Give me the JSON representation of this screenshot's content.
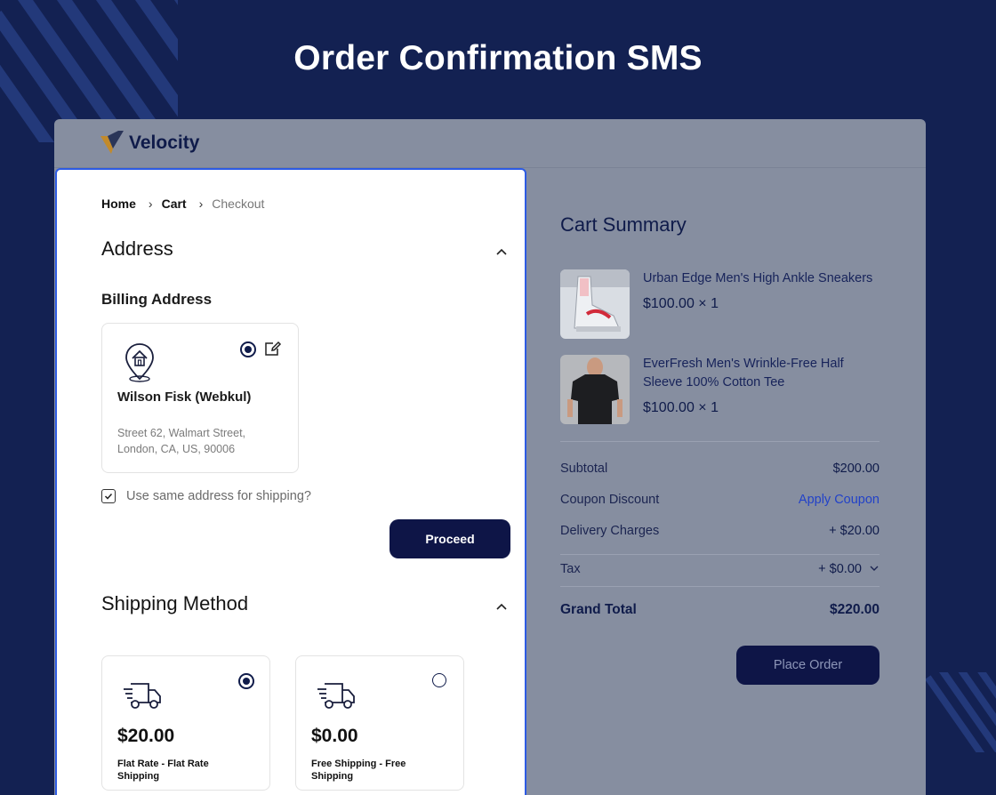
{
  "page": {
    "title": "Order Confirmation SMS"
  },
  "brand": {
    "name": "Velocity"
  },
  "breadcrumb": {
    "home": "Home",
    "cart": "Cart",
    "checkout": "Checkout"
  },
  "address": {
    "section_title": "Address",
    "billing_title": "Billing Address",
    "card": {
      "name": "Wilson Fisk (Webkul)",
      "line1": "Street 62, Walmart Street,",
      "line2": "London, CA, US, 90006",
      "selected": true
    },
    "same_address_label": "Use same address for shipping?",
    "same_address_checked": true,
    "proceed_label": "Proceed"
  },
  "shipping": {
    "section_title": "Shipping Method",
    "options": [
      {
        "price": "$20.00",
        "label": "Flat Rate - Flat Rate Shipping",
        "selected": true
      },
      {
        "price": "$0.00",
        "label": "Free Shipping - Free Shipping",
        "selected": false
      }
    ]
  },
  "summary": {
    "title": "Cart Summary",
    "items": [
      {
        "name": "Urban Edge Men's High Ankle Sneakers",
        "price": "$100.00 × 1"
      },
      {
        "name": "EverFresh Men's Wrinkle-Free Half Sleeve 100% Cotton Tee",
        "price": "$100.00 × 1"
      }
    ],
    "subtotal_label": "Subtotal",
    "subtotal_value": "$200.00",
    "coupon_label": "Coupon Discount",
    "coupon_action": "Apply Coupon",
    "delivery_label": "Delivery Charges",
    "delivery_value": "+ $20.00",
    "tax_label": "Tax",
    "tax_value": "+ $0.00",
    "grand_total_label": "Grand Total",
    "grand_total_value": "$220.00",
    "place_order_label": "Place Order"
  },
  "colors": {
    "background": "#132152",
    "primary_button": "#0e1547",
    "focus_border": "#2d5be3",
    "link": "#2242c8"
  }
}
